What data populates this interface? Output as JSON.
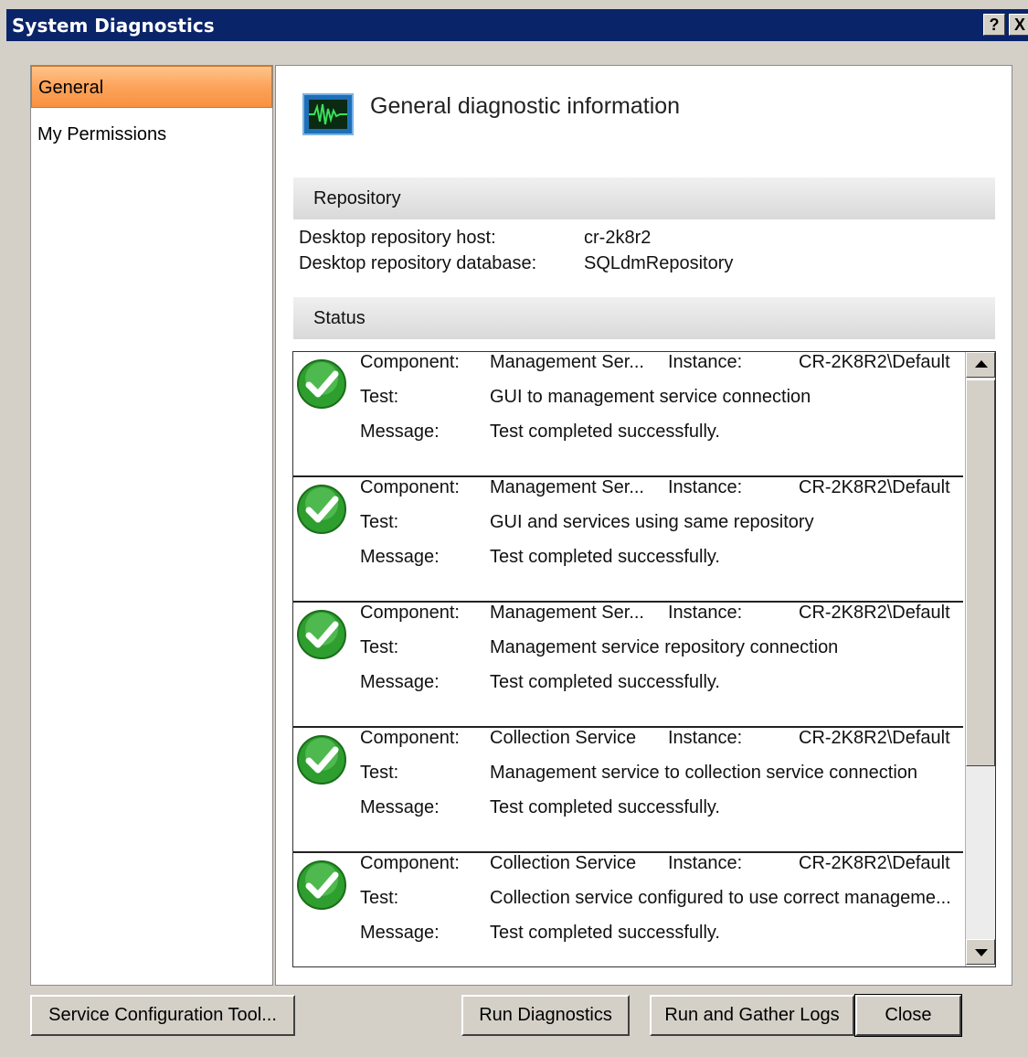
{
  "window": {
    "title": "System Diagnostics",
    "help_label": "?",
    "close_label": "X"
  },
  "sidebar": {
    "items": [
      {
        "label": "General",
        "selected": true
      },
      {
        "label": "My Permissions",
        "selected": false
      }
    ]
  },
  "content": {
    "header_title": "General diagnostic information",
    "header_icon": "monitor-waveform-icon",
    "repository": {
      "section_title": "Repository",
      "host_label": "Desktop repository host:",
      "host_value": "cr-2k8r2",
      "database_label": "Desktop repository database:",
      "database_value": "SQLdmRepository"
    },
    "status": {
      "section_title": "Status",
      "component_label": "Component:",
      "test_label": "Test:",
      "message_label": "Message:",
      "instance_label": "Instance:",
      "entries": [
        {
          "component": "Management Ser...",
          "instance": "CR-2K8R2\\Default",
          "test": "GUI to management service connection",
          "message": "Test completed successfully.",
          "icon": "success-check-icon"
        },
        {
          "component": "Management Ser...",
          "instance": "CR-2K8R2\\Default",
          "test": "GUI and services using same repository",
          "message": "Test completed successfully.",
          "icon": "success-check-icon"
        },
        {
          "component": "Management Ser...",
          "instance": "CR-2K8R2\\Default",
          "test": "Management service repository connection",
          "message": "Test completed successfully.",
          "icon": "success-check-icon"
        },
        {
          "component": "Collection Service",
          "instance": "CR-2K8R2\\Default",
          "test": "Management service to collection service connection",
          "message": "Test completed successfully.",
          "icon": "success-check-icon"
        },
        {
          "component": "Collection Service",
          "instance": "CR-2K8R2\\Default",
          "test": "Collection service configured to use correct manageme...",
          "message": "Test completed successfully.",
          "icon": "success-check-icon"
        }
      ]
    }
  },
  "buttons": {
    "service_config": "Service Configuration Tool...",
    "run_diagnostics": "Run Diagnostics",
    "run_gather_logs": "Run and Gather Logs",
    "close": "Close"
  },
  "colors": {
    "titlebar": "#0a246a",
    "selection": "#fca35a",
    "success": "#2e9e2e"
  }
}
